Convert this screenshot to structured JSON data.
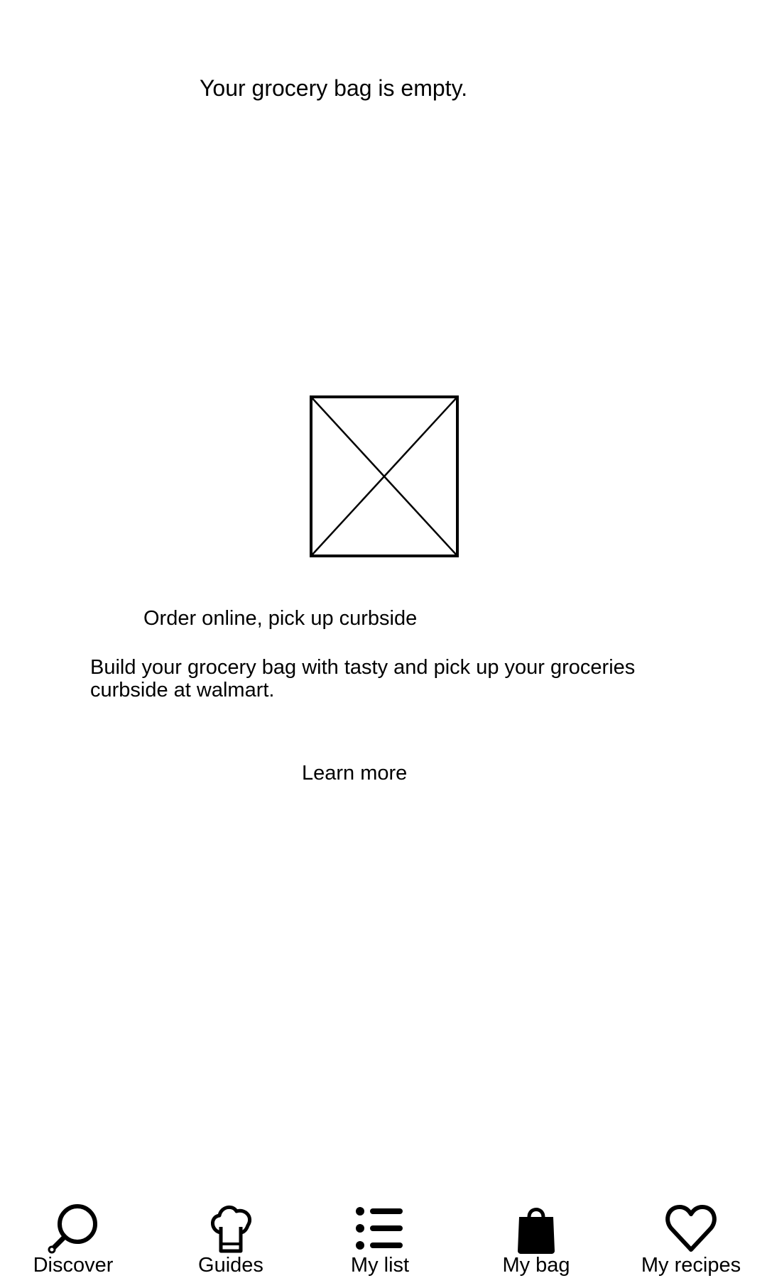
{
  "empty_state": {
    "title": "Your grocery bag is empty.",
    "image_icon": "image-placeholder-icon"
  },
  "promo": {
    "heading": "Order online, pick up curbside",
    "body": "Build your grocery bag with tasty and pick up your groceries curbside at walmart.",
    "link_label": "Learn more"
  },
  "bottom_nav": {
    "items": [
      {
        "label": "Discover",
        "icon": "search-icon"
      },
      {
        "label": "Guides",
        "icon": "chef-hat-icon"
      },
      {
        "label": "My list",
        "icon": "list-icon"
      },
      {
        "label": "My bag",
        "icon": "shopping-bag-icon"
      },
      {
        "label": "My recipes",
        "icon": "heart-icon"
      }
    ],
    "selected": "My bag"
  }
}
